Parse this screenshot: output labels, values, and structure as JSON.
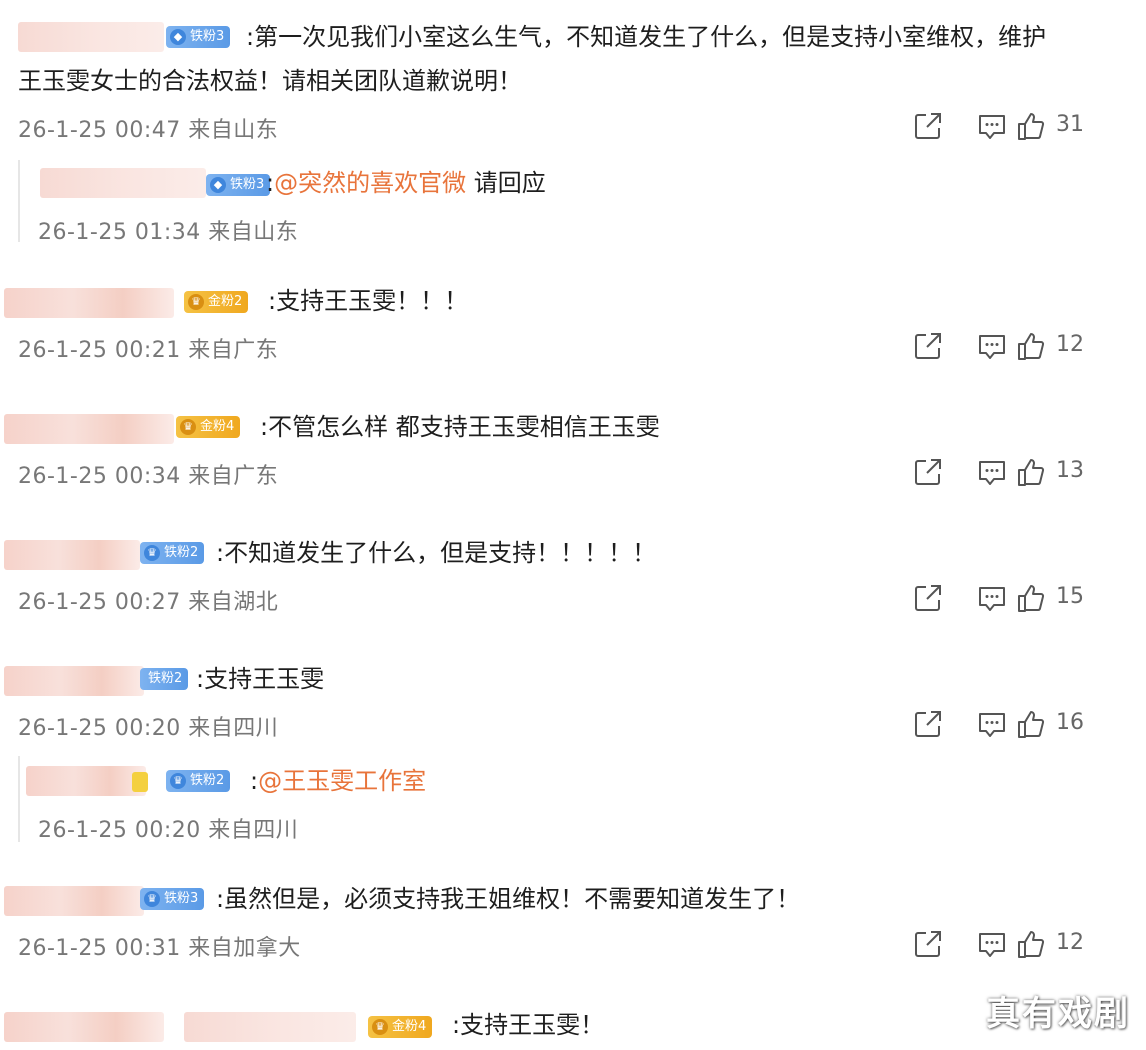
{
  "comments": [
    {
      "badge": "铁粉3",
      "badge_type": "iron",
      "text": ":第一次见我们小室这么生气，不知道发生了什么，但是支持小室维权，维护",
      "text2": "王玉雯女士的合法权益！请相关团队道歉说明！",
      "time": "26-1-25 00:47",
      "location": "来自山东",
      "likes": "31",
      "reply": {
        "badge": "铁粉3",
        "badge_type": "iron",
        "prefix": ":",
        "mention": "@突然的喜欢官微",
        "text": " 请回应",
        "time": "26-1-25 01:34",
        "location": "来自山东"
      }
    },
    {
      "badge": "金粉2",
      "badge_type": "gold",
      "text": ":支持王玉雯！！！",
      "time": "26-1-25 00:21",
      "location": "来自广东",
      "likes": "12"
    },
    {
      "badge": "金粉4",
      "badge_type": "gold",
      "text": ":不管怎么样 都支持王玉雯相信王玉雯",
      "time": "26-1-25 00:34",
      "location": "来自广东",
      "likes": "13"
    },
    {
      "badge": "铁粉2",
      "badge_type": "iron",
      "text": ":不知道发生了什么，但是支持！！！！！",
      "time": "26-1-25 00:27",
      "location": "来自湖北",
      "likes": "15"
    },
    {
      "badge": "铁粉2",
      "badge_type": "iron",
      "text": ":支持王玉雯",
      "time": "26-1-25 00:20",
      "location": "来自四川",
      "likes": "16",
      "reply": {
        "badge": "铁粉2",
        "badge_type": "iron",
        "prefix": ":",
        "mention": "@王玉雯工作室",
        "text": "",
        "time": "26-1-25 00:20",
        "location": "来自四川"
      }
    },
    {
      "badge": "铁粉3",
      "badge_type": "iron",
      "text": ":虽然但是，必须支持我王姐维权！不需要知道发生了！",
      "time": "26-1-25 00:31",
      "location": "来自加拿大",
      "likes": "12"
    },
    {
      "badge": "金粉4",
      "badge_type": "gold",
      "text": ":支持王玉雯！"
    }
  ],
  "icons": {
    "share": "share-icon",
    "comment": "comment-icon",
    "like": "thumbs-up-icon",
    "badge_iron": "diamond-icon",
    "badge_gold": "crown-icon"
  },
  "colors": {
    "mention": "#e8743b",
    "badge_iron": "#5a9ae6",
    "badge_gold": "#f0a81f",
    "meta": "#777777"
  },
  "watermark": "真有戏剧"
}
